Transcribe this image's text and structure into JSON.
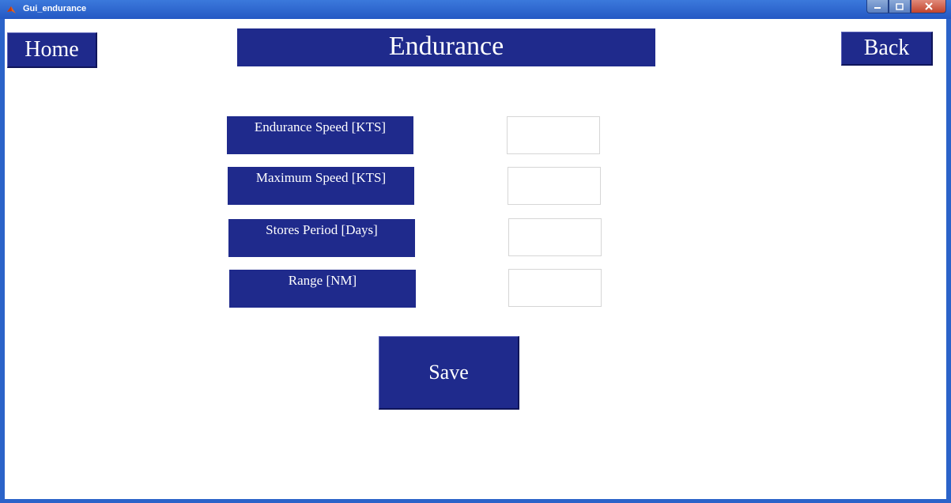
{
  "window": {
    "title": "Gui_endurance"
  },
  "header": {
    "home_label": "Home",
    "title": "Endurance",
    "back_label": "Back"
  },
  "fields": [
    {
      "label": "Endurance Speed [KTS]",
      "value": ""
    },
    {
      "label": "Maximum Speed [KTS]",
      "value": ""
    },
    {
      "label": "Stores Period  [Days]",
      "value": ""
    },
    {
      "label": "Range [NM]",
      "value": ""
    }
  ],
  "actions": {
    "save_label": "Save"
  },
  "colors": {
    "button_bg": "#1f2a8c",
    "titlebar": "#2b63c9",
    "background": "#ffffff"
  },
  "icons": {
    "app": "matlab-icon",
    "minimize": "minimize-icon",
    "maximize": "maximize-icon",
    "close": "close-icon"
  }
}
